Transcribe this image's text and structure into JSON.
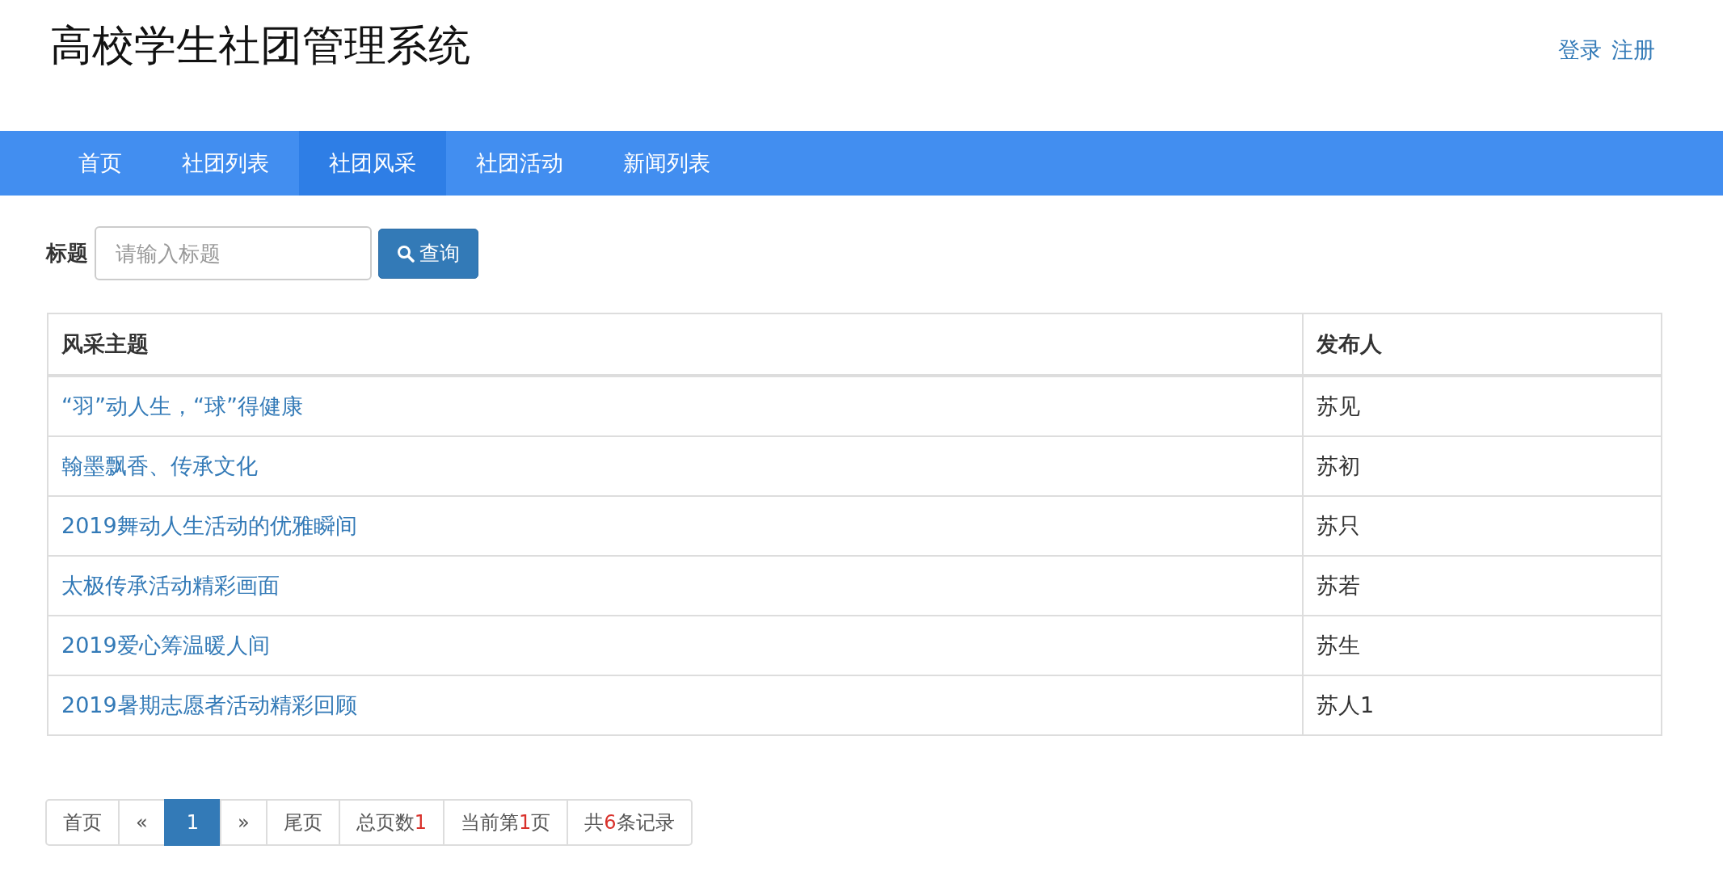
{
  "header": {
    "title": "高校学生社团管理系统",
    "links": [
      "登录",
      "注册"
    ]
  },
  "nav": [
    {
      "label": "首页",
      "selected": false
    },
    {
      "label": "社团列表",
      "selected": false
    },
    {
      "label": "社团风采",
      "selected": true
    },
    {
      "label": "社团活动",
      "selected": false
    },
    {
      "label": "新闻列表",
      "selected": false
    }
  ],
  "search": {
    "label": "标题",
    "placeholder": "请输入标题",
    "button": "查询"
  },
  "table": {
    "columns": [
      "风采主题",
      "发布人"
    ],
    "rows": [
      {
        "topic": "“羽”动人生，“球”得健康",
        "publisher": "苏见"
      },
      {
        "topic": "翰墨飘香、传承文化",
        "publisher": "苏初"
      },
      {
        "topic": "2019舞动人生活动的优雅瞬间",
        "publisher": "苏只"
      },
      {
        "topic": "太极传承活动精彩画面",
        "publisher": "苏若"
      },
      {
        "topic": "2019爱心筹温暖人间",
        "publisher": "苏生"
      },
      {
        "topic": "2019暑期志愿者活动精彩回顾",
        "publisher": "苏人1"
      }
    ]
  },
  "pagination": [
    {
      "kind": "link",
      "text": "首页"
    },
    {
      "kind": "link",
      "text": "«"
    },
    {
      "kind": "page",
      "text": "1",
      "selected": true
    },
    {
      "kind": "link",
      "text": "»"
    },
    {
      "kind": "link",
      "text": "尾页"
    },
    {
      "kind": "info",
      "prefix": "总页数",
      "number": "1"
    },
    {
      "kind": "info",
      "prefix": "当前第",
      "number": "1",
      "suffix": "页"
    },
    {
      "kind": "info",
      "prefix": "共",
      "number": "6",
      "suffix": "条记录"
    }
  ]
}
